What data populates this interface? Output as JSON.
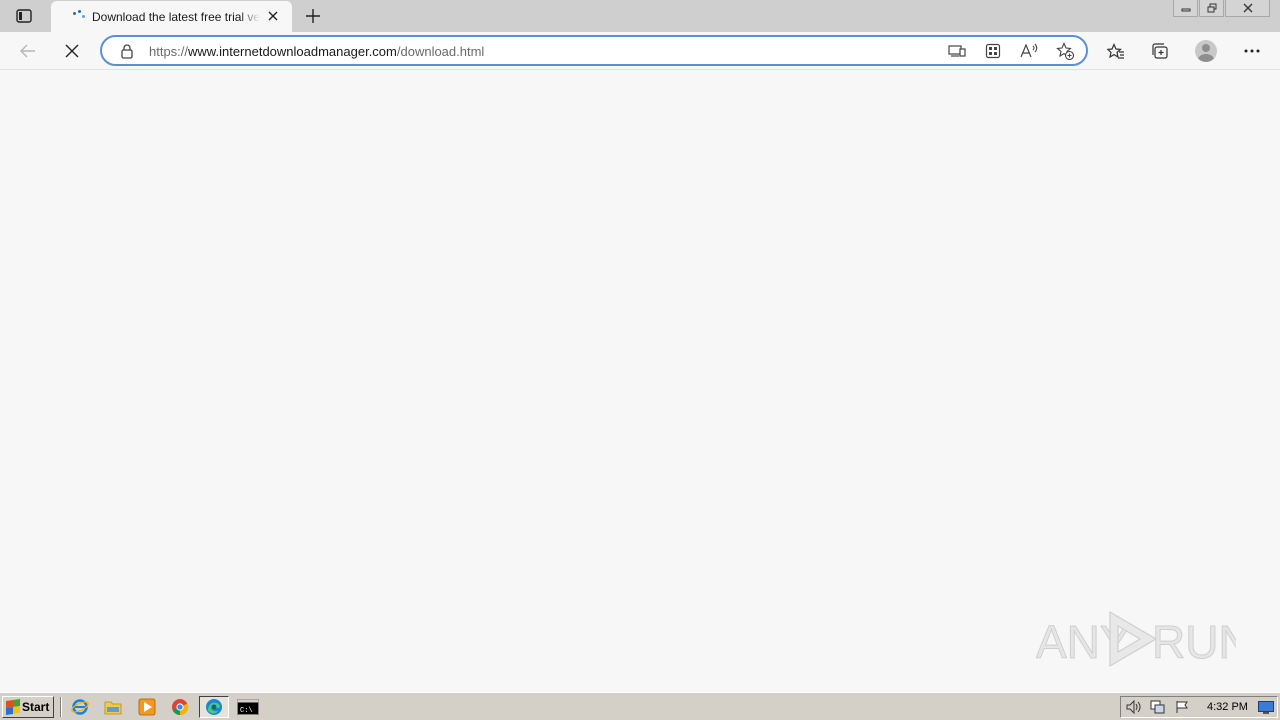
{
  "tab": {
    "title": "Download the latest free trial version of Internet Download Manager",
    "close_icon": "close-icon",
    "favicon": "loading-spinner-icon"
  },
  "new_tab_icon": "plus-icon",
  "window_controls": [
    "minimize-icon",
    "restore-icon",
    "close-icon"
  ],
  "toolbar": {
    "back_icon": "back-arrow-icon",
    "stop_icon": "stop-loading-icon",
    "url_scheme": "https://",
    "url_host": "www.internetdownloadmanager.com",
    "url_path": "/download.html",
    "address_icons": [
      "app-available-icon",
      "apps-icon",
      "read-aloud-icon",
      "add-favorite-icon"
    ],
    "right_icons": [
      "favorites-icon",
      "collections-icon",
      "profile-avatar",
      "more-menu-icon"
    ]
  },
  "watermark": {
    "text_left": "ANY",
    "text_right": "RUN"
  },
  "taskbar": {
    "start_label": "Start",
    "quick_launch": [
      "internet-explorer-icon",
      "windows-explorer-icon",
      "media-player-icon",
      "chrome-icon",
      "edge-icon",
      "command-prompt-icon"
    ],
    "cmd_label": "C:\\",
    "tray_icons": [
      "volume-icon",
      "network-icon",
      "action-center-flag-icon"
    ],
    "clock": "4:32 PM",
    "show_desktop_icon": "show-desktop-icon"
  },
  "colors": {
    "address_border": "#5b8fd6",
    "tabstrip_bg": "#cfcfcf",
    "page_bg": "#f7f7f7",
    "taskbar_bg": "#d4d0c8"
  }
}
